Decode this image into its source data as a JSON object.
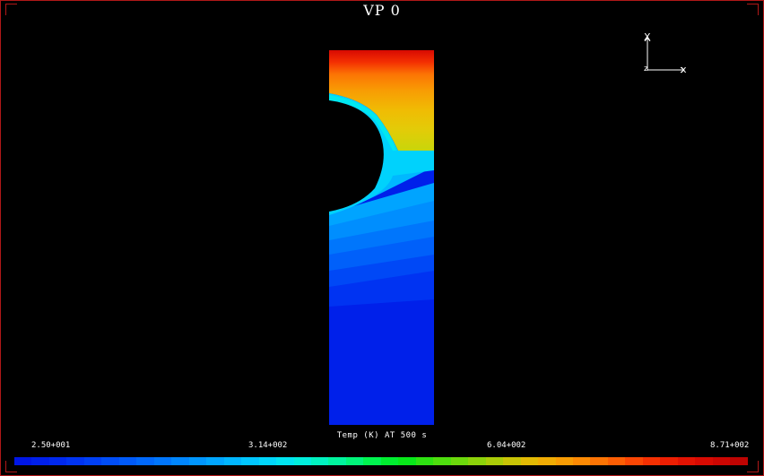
{
  "viewport": {
    "title": "VP 0"
  },
  "plot": {
    "caption": "Temp (K) AT 500 s"
  },
  "triad": {
    "axis_x_up": "X",
    "axis_x_right": "x",
    "origin": "z"
  },
  "legend": {
    "tick_labels": [
      "2.50+001",
      "3.14+002",
      "6.04+002",
      "8.71+002"
    ],
    "colors": [
      "#0016e6",
      "#001fea",
      "#0028ee",
      "#0033f2",
      "#003ff5",
      "#004df7",
      "#005af9",
      "#0068fb",
      "#0076fc",
      "#0086fd",
      "#0096fe",
      "#00a6ff",
      "#00b6ff",
      "#00c6ff",
      "#00d6fa",
      "#00e4f0",
      "#00eedc",
      "#00f2c0",
      "#00f49e",
      "#00f47a",
      "#00f450",
      "#00ee30",
      "#08e81a",
      "#2ee212",
      "#4ede0e",
      "#6cd80c",
      "#8cd20a",
      "#aacc08",
      "#c8c406",
      "#e2ba04",
      "#f0ac04",
      "#f89c04",
      "#fc8a04",
      "#fc7404",
      "#fc5e04",
      "#fa4604",
      "#f43002",
      "#ec1e02",
      "#e21202",
      "#d80a02",
      "#cc0602",
      "#be0402"
    ]
  }
}
